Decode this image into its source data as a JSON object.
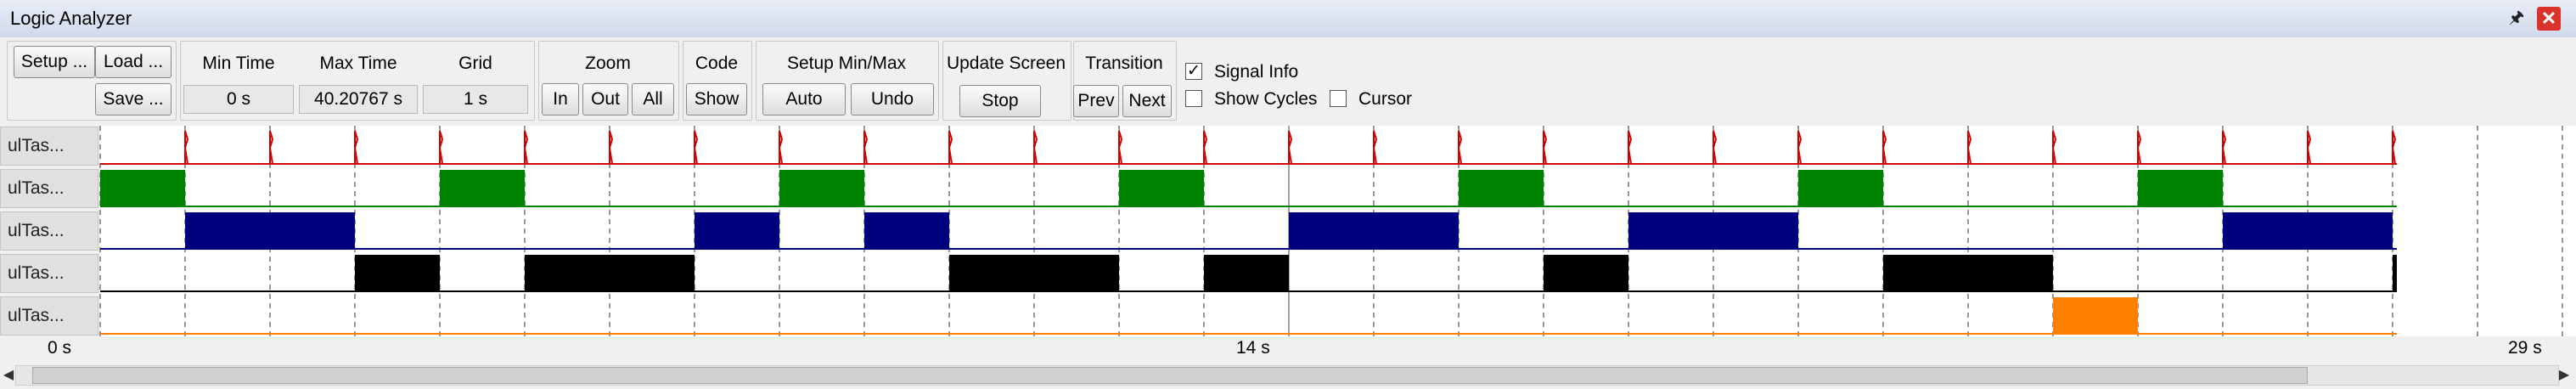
{
  "window": {
    "title": "Logic Analyzer"
  },
  "toolbar": {
    "setup_label": "Setup ...",
    "load_label": "Load ...",
    "save_label": "Save ...",
    "min_time": {
      "label": "Min Time",
      "value": "0 s"
    },
    "max_time": {
      "label": "Max Time",
      "value": "40.20767 s"
    },
    "grid": {
      "label": "Grid",
      "value": "1 s"
    },
    "zoom": {
      "label": "Zoom",
      "in": "In",
      "out": "Out",
      "all": "All"
    },
    "code": {
      "label": "Code",
      "show": "Show"
    },
    "setup_minmax": {
      "label": "Setup Min/Max",
      "auto": "Auto",
      "undo": "Undo"
    },
    "update_screen": {
      "label": "Update Screen",
      "stop": "Stop"
    },
    "transition": {
      "label": "Transition",
      "prev": "Prev",
      "next": "Next"
    },
    "options": {
      "signal_info": {
        "label": "Signal Info",
        "checked": true
      },
      "show_cycles": {
        "label": "Show Cycles",
        "checked": false
      },
      "cursor": {
        "label": "Cursor",
        "checked": false
      }
    }
  },
  "signals": [
    {
      "name": "ulTas...",
      "color": "#d00000",
      "kind": "pulse",
      "pulses": [
        1,
        2,
        3,
        4,
        5,
        6,
        7,
        8,
        9,
        10,
        11,
        12,
        13,
        14,
        15,
        16,
        17,
        18,
        19,
        20,
        21,
        22,
        23,
        24,
        25,
        26,
        27
      ]
    },
    {
      "name": "ulTas...",
      "color": "#008000",
      "kind": "block",
      "segments": [
        [
          0,
          1
        ],
        [
          4,
          5
        ],
        [
          8,
          9
        ],
        [
          12,
          13
        ],
        [
          16,
          17
        ],
        [
          20,
          21
        ],
        [
          24,
          25
        ]
      ]
    },
    {
      "name": "ulTas...",
      "color": "#00007f",
      "kind": "block",
      "segments": [
        [
          1,
          3
        ],
        [
          7,
          8
        ],
        [
          9,
          10
        ],
        [
          14,
          16
        ],
        [
          18,
          20
        ],
        [
          25,
          27
        ]
      ]
    },
    {
      "name": "ulTas...",
      "color": "#000000",
      "kind": "block",
      "segments": [
        [
          3,
          4
        ],
        [
          5,
          7
        ],
        [
          10,
          12
        ],
        [
          13,
          14
        ],
        [
          17,
          18
        ],
        [
          21,
          23
        ],
        [
          27,
          27.05
        ]
      ]
    },
    {
      "name": "ulTas...",
      "color": "#ff8000",
      "kind": "block",
      "segments": [
        [
          23,
          24
        ]
      ]
    }
  ],
  "timeline": {
    "start_label": "0 s",
    "mid_label": "14 s",
    "end_label": "29 s",
    "visible_range_s": [
      0,
      29
    ],
    "data_end_s": 27.05,
    "grid_s": 1,
    "cursor_s": 14
  },
  "colors": {
    "grid": "#555555",
    "accent_close": "#d9332b",
    "plot_bg": "#ffffff"
  }
}
